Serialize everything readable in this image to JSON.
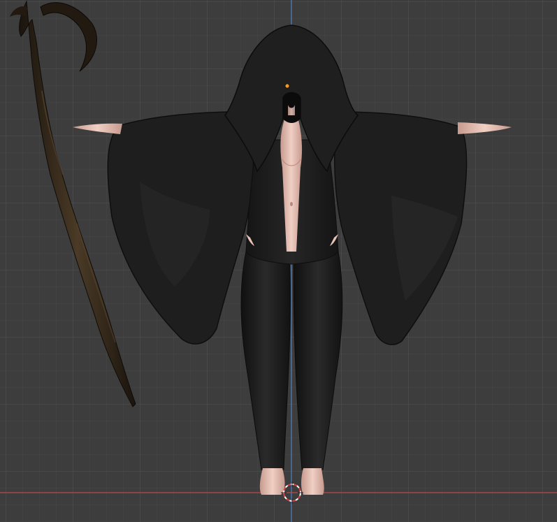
{
  "viewport": {
    "background_color": "#3d3d3d",
    "grid_minor_color": "#474747",
    "grid_major_color": "#505050",
    "axis_x_color": "#c0474f",
    "axis_z_color": "#4a7ec4",
    "origin_marker_color": "#f39a1c"
  },
  "scene": {
    "objects": [
      {
        "name": "scythe",
        "material_color": "#2b2217"
      },
      {
        "name": "reaper-character",
        "robe_color": "#1d1d1d",
        "skin_color": "#e8c4b8"
      },
      {
        "name": "3d-cursor",
        "colors": [
          "#d94040",
          "#ffffff"
        ]
      }
    ]
  }
}
